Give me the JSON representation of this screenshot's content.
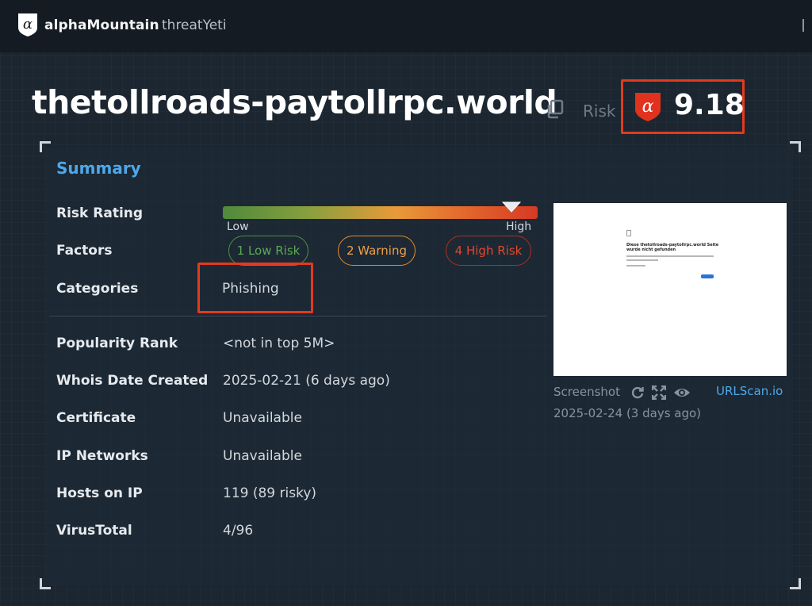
{
  "topbar": {
    "brand_name": "alphaMountain",
    "product_name": "threatYeti",
    "logo_glyph": "α"
  },
  "header": {
    "domain": "thetollroads-paytollrpc.world",
    "risk_label": "Risk",
    "risk_score": "9.18",
    "risk_glyph": "α"
  },
  "colors": {
    "accent_blue": "#4ea8ea",
    "highlight_red": "#e33a1e",
    "low_green": "#5ea856",
    "warning_orange": "#efa04a",
    "high_red": "#e4462c"
  },
  "summary": {
    "title": "Summary",
    "risk_rating": {
      "label": "Risk Rating",
      "low_label": "Low",
      "high_label": "High",
      "level": 0.918
    },
    "factors": {
      "label": "Factors",
      "low_risk": "1 Low Risk",
      "warning": "2 Warning",
      "high_risk": "4 High Risk"
    },
    "categories": {
      "label": "Categories",
      "value": "Phishing"
    },
    "rows": [
      {
        "label": "Popularity Rank",
        "value": "<not in top 5M>"
      },
      {
        "label": "Whois Date Created",
        "value": "2025-02-21 (6 days ago)"
      },
      {
        "label": "Certificate",
        "value": "Unavailable"
      },
      {
        "label": "IP Networks",
        "value": "Unavailable"
      },
      {
        "label": "Hosts on IP",
        "value": "119 (89 risky)"
      },
      {
        "label": "VirusTotal",
        "value": "4/96"
      }
    ]
  },
  "screenshot": {
    "label": "Screenshot",
    "source_link": "URLScan.io",
    "date": "2025-02-24 (3 days ago)",
    "preview_title": "Diese thetollroads-paytollrpc.world Seite wurde nicht gefunden",
    "icons": [
      "refresh-icon",
      "expand-icon",
      "eye-icon"
    ]
  }
}
